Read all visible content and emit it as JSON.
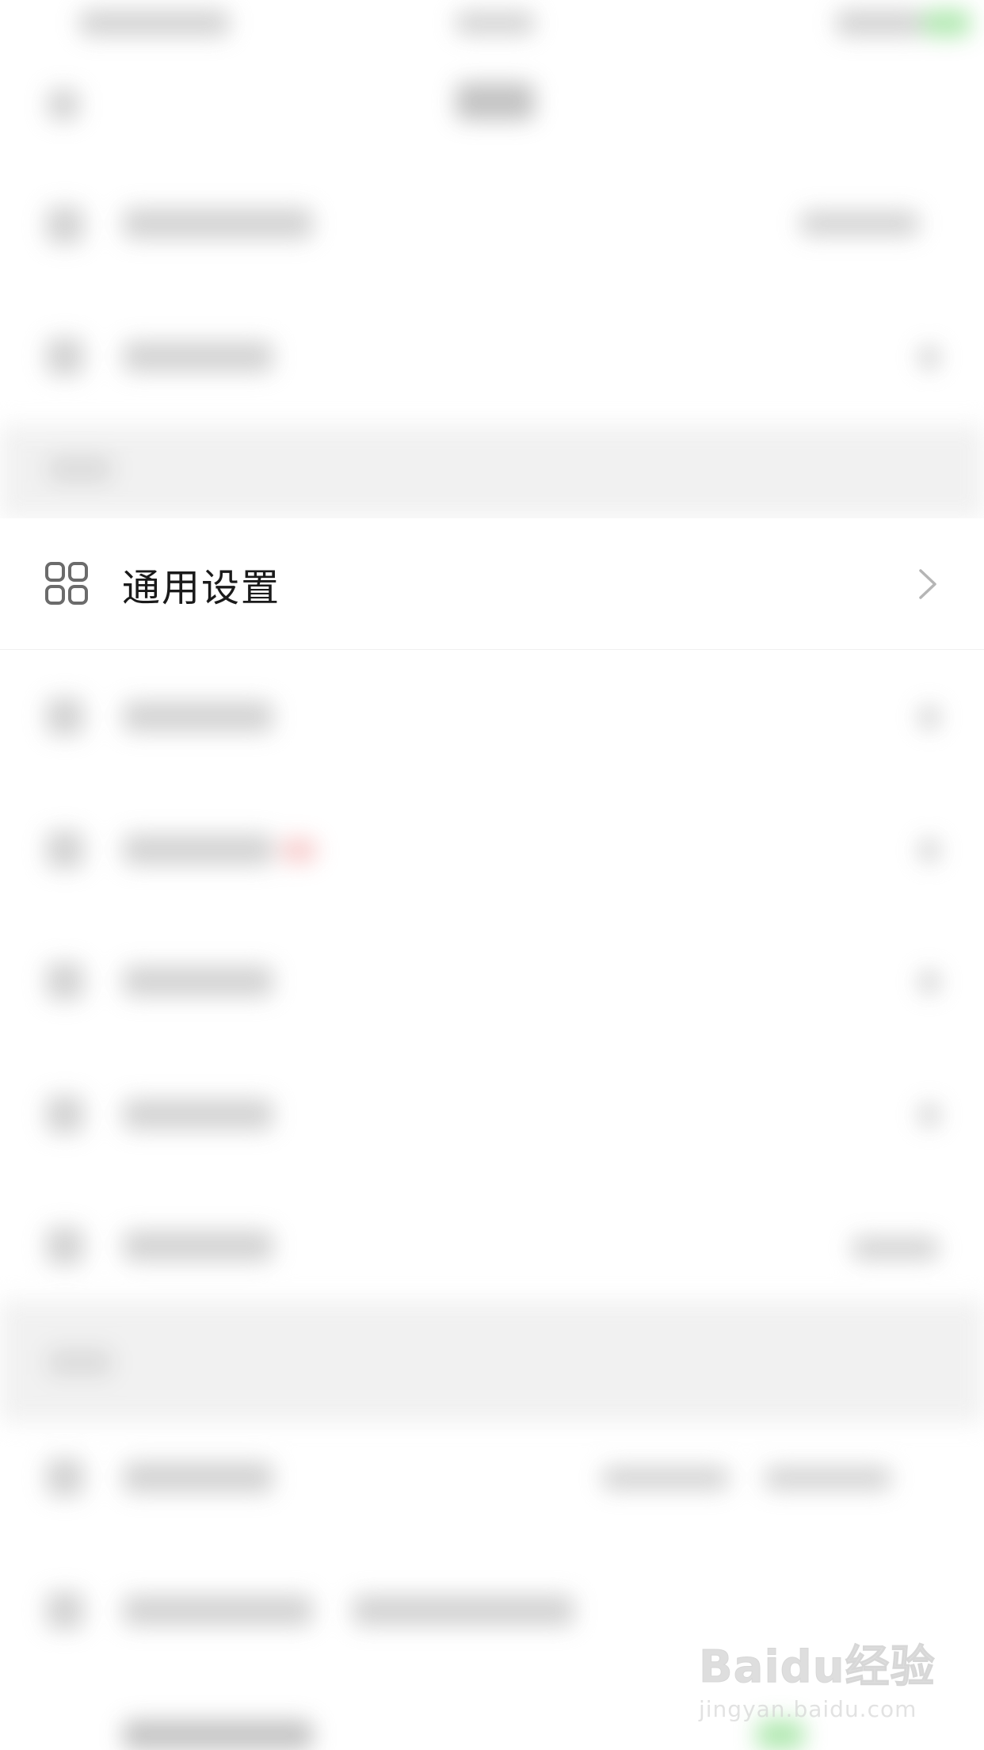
{
  "settings_list": {
    "focused_item": {
      "label": "通用设置",
      "icon": "grid-icon",
      "trailing_icon": "chevron-right-icon"
    }
  },
  "watermark": {
    "logo_text": "Baidu经验",
    "url_text": "jingyan.baidu.com"
  },
  "colors": {
    "text_primary": "#1a1a1a",
    "icon_gray": "#6b6b6b",
    "chevron_gray": "#b5b5b5",
    "section_bg": "#f0f0f0",
    "accent_green": "#4cd964"
  }
}
